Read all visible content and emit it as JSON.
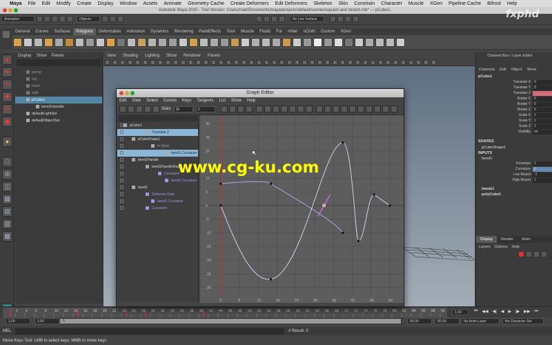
{
  "mac_menu": [
    "Maya",
    "File",
    "Edit",
    "Modify",
    "Create",
    "Display",
    "Window",
    "Assets",
    "Animate",
    "Geometry Cache",
    "Create Deformers",
    "Edit Deformers",
    "Skeleton",
    "Skin",
    "Constrain",
    "Character",
    "Muscle",
    "XGen",
    "Pipeline Cache",
    "Bifrost",
    "Help"
  ],
  "window_title": "Autodesk Maya 2015 - Trial Version: /Users/matt/Documents/maya/projects/default/scenes/squash and stretch.mb* --- pCube1...",
  "status_line": {
    "menuset": "Animation",
    "selection_mode": "Objects",
    "live_surface": "No Live Surface"
  },
  "shelf_tabs": [
    "General",
    "Curves",
    "Surfaces",
    "Polygons",
    "Deformation",
    "Animation",
    "Dynamics",
    "Rendering",
    "PaintEffects",
    "Toon",
    "Muscle",
    "Fluids",
    "Fur",
    "nHair",
    "nCloth",
    "Custom",
    "XGen"
  ],
  "shelf_active_tab": "Polygons",
  "outliner": {
    "menu": [
      "Display",
      "Show",
      "Panels"
    ],
    "items": [
      {
        "label": "persp",
        "dim": true,
        "selected": false
      },
      {
        "label": "top",
        "dim": true,
        "selected": false
      },
      {
        "label": "front",
        "dim": true,
        "selected": false
      },
      {
        "label": "side",
        "dim": true,
        "selected": false
      },
      {
        "label": "pCube1",
        "dim": false,
        "selected": true
      },
      {
        "label": "bend1Handle",
        "dim": false,
        "selected": false
      },
      {
        "label": "defaultLightSet",
        "dim": false,
        "selected": false
      },
      {
        "label": "defaultObjectSet",
        "dim": false,
        "selected": false
      }
    ]
  },
  "viewport_menu": [
    "View",
    "Shading",
    "Lighting",
    "Show",
    "Renderer",
    "Panels"
  ],
  "graph_editor": {
    "title": "Graph Editor",
    "menu": [
      "Edit",
      "View",
      "Select",
      "Curves",
      "Keys",
      "Tangents",
      "List",
      "Show",
      "Help"
    ],
    "stats_label": "Stats",
    "stats_value1": "30",
    "stats_value2": "0",
    "outliner": [
      {
        "label": "pCube1",
        "indent": 18,
        "style": "normal"
      },
      {
        "label": "Translate Z",
        "indent": 50,
        "style": "sel"
      },
      {
        "label": "pCubeShape1",
        "indent": 30,
        "style": "normal"
      },
      {
        "label": "In Mesh",
        "indent": 58,
        "style": "dim"
      },
      {
        "label": "bend1.Curvature",
        "indent": 78,
        "style": "sel"
      },
      {
        "label": "bend1Handle",
        "indent": 30,
        "style": "normal"
      },
      {
        "label": "bend1HandleShape",
        "indent": 50,
        "style": "normal"
      },
      {
        "label": "Curvature",
        "indent": 68,
        "style": "purple"
      },
      {
        "label": "bend1.Curvature",
        "indent": 78,
        "style": "purple"
      },
      {
        "label": "bend1",
        "indent": 30,
        "style": "normal"
      },
      {
        "label": "Deformer Data",
        "indent": 50,
        "style": "purple"
      },
      {
        "label": "bend1.Curvature",
        "indent": 58,
        "style": "purple"
      },
      {
        "label": "Curvature",
        "indent": 50,
        "style": "purple"
      }
    ],
    "y_ticks": [
      "30",
      "25",
      "20",
      "15",
      "10",
      "5",
      "0",
      "-5",
      "-10",
      "-15",
      "-20",
      "-25",
      "-30"
    ],
    "x_ticks": [
      "0",
      "6",
      "12",
      "18",
      "24",
      "30",
      "36",
      "42",
      "48",
      "54"
    ]
  },
  "channel_box": {
    "header": "Channel Box / Layer Editor",
    "menu": [
      "Channels",
      "Edit",
      "Object",
      "Show"
    ],
    "object": "pCube1",
    "attributes": [
      {
        "name": "Translate X",
        "value": "0",
        "hl": false
      },
      {
        "name": "Translate Y",
        "value": "3",
        "hl": false
      },
      {
        "name": "Translate Z",
        "value": "",
        "hl": true
      },
      {
        "name": "Rotate X",
        "value": "0",
        "hl": false
      },
      {
        "name": "Rotate Y",
        "value": "0",
        "hl": false
      },
      {
        "name": "Rotate Z",
        "value": "0",
        "hl": false
      },
      {
        "name": "Scale X",
        "value": "1",
        "hl": false
      },
      {
        "name": "Scale Y",
        "value": "1",
        "hl": false
      },
      {
        "name": "Scale Z",
        "value": "1",
        "hl": false
      },
      {
        "name": "Visibility",
        "value": "on",
        "hl": false
      }
    ],
    "shapes_label": "SHAPES",
    "shape_name": "pCubeShape1",
    "inputs_label": "INPUTS",
    "input_name": "bend1",
    "input_attrs": [
      {
        "name": "Envelope",
        "value": "1",
        "blue": false
      },
      {
        "name": "Curvature",
        "value": "0",
        "blue": true
      },
      {
        "name": "Low Bound",
        "value": "-1",
        "blue": false
      },
      {
        "name": "High Bound",
        "value": "1",
        "blue": false
      }
    ],
    "extra": [
      "tweak1",
      "polyCube1"
    ],
    "layer_tabs": [
      "Display",
      "Render",
      "Anim"
    ],
    "layer_menu": [
      "Layers",
      "Options",
      "Help"
    ]
  },
  "time_slider": {
    "ticks": [
      "2",
      "4",
      "6",
      "8",
      "10",
      "12",
      "14",
      "16",
      "18",
      "20",
      "22",
      "24",
      "26",
      "28",
      "30",
      "32",
      "34",
      "36",
      "38",
      "40",
      "42",
      "44",
      "46",
      "48",
      "50",
      "52",
      "54",
      "56",
      "58",
      "60",
      "62",
      "64",
      "66",
      "68",
      "70",
      "72",
      "74",
      "76",
      "78",
      "80",
      "82",
      "84",
      "86",
      "88",
      "90"
    ],
    "current_frame": "1.00"
  },
  "range_slider": {
    "start": "1.00",
    "start2": "1.00",
    "inner_start": "1",
    "end": "90.00",
    "end2": "90.00",
    "anim_layer": "No Anim Layer",
    "char_set": "No Character Set"
  },
  "command_line": {
    "label": "MEL",
    "result": "// Result: 0"
  },
  "help_line": "Move Keys Tool: LMB to select keys; MMB to move keys",
  "watermarks": {
    "center": "www.cg-ku.com",
    "corner": "fxphd"
  },
  "colors": {
    "curve_z": "#a8a8e0",
    "curve_bend": "#d0d0f0",
    "selection": "#5285a6",
    "time_marker": "#d0333c"
  }
}
